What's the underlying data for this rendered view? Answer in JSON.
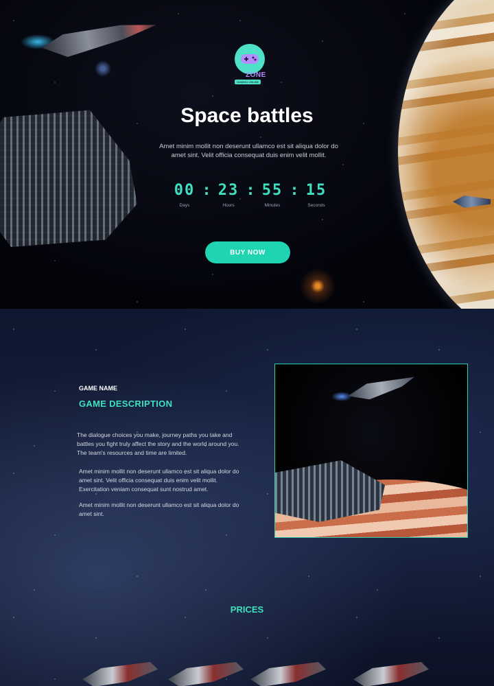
{
  "logo": {
    "name": "ZONE",
    "tagline": "GAMING ONLINE",
    "icon": "gamepad-icon"
  },
  "hero": {
    "title": "Space battles",
    "description": "Amet minim mollit non deserunt ullamco est sit aliqua dolor do amet sint. Velit officia consequat duis enim velit mollit.",
    "countdown": {
      "days": "00",
      "hours": "23",
      "minutes": "55",
      "seconds": "15",
      "sep1": ":",
      "sep2": ":",
      "sep3": ":",
      "labels": {
        "days": "Days",
        "hours": "Hours",
        "minutes": "Minutes",
        "seconds": "Seconds"
      }
    },
    "button": "BUY NOW"
  },
  "about": {
    "eyebrow": "GAME NAME",
    "heading": "GAME DESCRIPTION",
    "paragraphs": [
      "The dialogue choices you make, journey paths you take and battles you fight truly affect the story and the world around you. The team's resources and time are limited.",
      "Amet minim mollit non deserunt ullamco est sit aliqua dolor do amet sint. Velit officia consequat duis enim velit mollit. Exercitation veniam consequat sunt nostrud amet.",
      "Amet minim mollit non deserunt ullamco est sit aliqua dolor do amet sint."
    ]
  },
  "prices": {
    "heading": "PRICES"
  },
  "colors": {
    "accent": "#1fd4b0",
    "accent_text": "#3fe0c0",
    "logo_purple": "#b58cff"
  }
}
